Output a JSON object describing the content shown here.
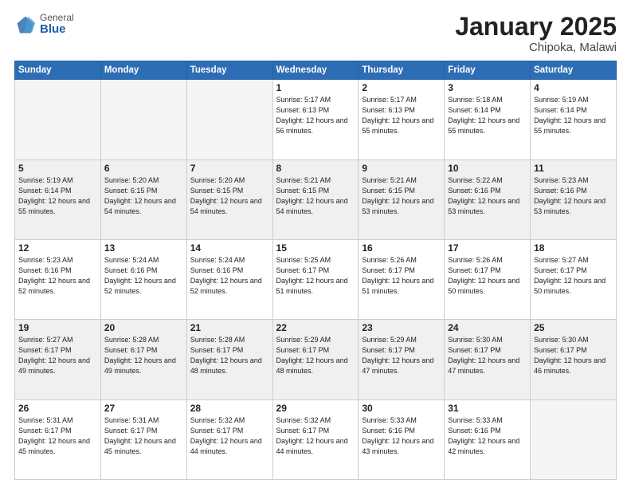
{
  "header": {
    "logo_general": "General",
    "logo_blue": "Blue",
    "month_title": "January 2025",
    "location": "Chipoka, Malawi"
  },
  "weekdays": [
    "Sunday",
    "Monday",
    "Tuesday",
    "Wednesday",
    "Thursday",
    "Friday",
    "Saturday"
  ],
  "weeks": [
    {
      "shaded": false,
      "days": [
        {
          "num": "",
          "info": ""
        },
        {
          "num": "",
          "info": ""
        },
        {
          "num": "",
          "info": ""
        },
        {
          "num": "1",
          "info": "Sunrise: 5:17 AM\nSunset: 6:13 PM\nDaylight: 12 hours\nand 56 minutes."
        },
        {
          "num": "2",
          "info": "Sunrise: 5:17 AM\nSunset: 6:13 PM\nDaylight: 12 hours\nand 55 minutes."
        },
        {
          "num": "3",
          "info": "Sunrise: 5:18 AM\nSunset: 6:14 PM\nDaylight: 12 hours\nand 55 minutes."
        },
        {
          "num": "4",
          "info": "Sunrise: 5:19 AM\nSunset: 6:14 PM\nDaylight: 12 hours\nand 55 minutes."
        }
      ]
    },
    {
      "shaded": true,
      "days": [
        {
          "num": "5",
          "info": "Sunrise: 5:19 AM\nSunset: 6:14 PM\nDaylight: 12 hours\nand 55 minutes."
        },
        {
          "num": "6",
          "info": "Sunrise: 5:20 AM\nSunset: 6:15 PM\nDaylight: 12 hours\nand 54 minutes."
        },
        {
          "num": "7",
          "info": "Sunrise: 5:20 AM\nSunset: 6:15 PM\nDaylight: 12 hours\nand 54 minutes."
        },
        {
          "num": "8",
          "info": "Sunrise: 5:21 AM\nSunset: 6:15 PM\nDaylight: 12 hours\nand 54 minutes."
        },
        {
          "num": "9",
          "info": "Sunrise: 5:21 AM\nSunset: 6:15 PM\nDaylight: 12 hours\nand 53 minutes."
        },
        {
          "num": "10",
          "info": "Sunrise: 5:22 AM\nSunset: 6:16 PM\nDaylight: 12 hours\nand 53 minutes."
        },
        {
          "num": "11",
          "info": "Sunrise: 5:23 AM\nSunset: 6:16 PM\nDaylight: 12 hours\nand 53 minutes."
        }
      ]
    },
    {
      "shaded": false,
      "days": [
        {
          "num": "12",
          "info": "Sunrise: 5:23 AM\nSunset: 6:16 PM\nDaylight: 12 hours\nand 52 minutes."
        },
        {
          "num": "13",
          "info": "Sunrise: 5:24 AM\nSunset: 6:16 PM\nDaylight: 12 hours\nand 52 minutes."
        },
        {
          "num": "14",
          "info": "Sunrise: 5:24 AM\nSunset: 6:16 PM\nDaylight: 12 hours\nand 52 minutes."
        },
        {
          "num": "15",
          "info": "Sunrise: 5:25 AM\nSunset: 6:17 PM\nDaylight: 12 hours\nand 51 minutes."
        },
        {
          "num": "16",
          "info": "Sunrise: 5:26 AM\nSunset: 6:17 PM\nDaylight: 12 hours\nand 51 minutes."
        },
        {
          "num": "17",
          "info": "Sunrise: 5:26 AM\nSunset: 6:17 PM\nDaylight: 12 hours\nand 50 minutes."
        },
        {
          "num": "18",
          "info": "Sunrise: 5:27 AM\nSunset: 6:17 PM\nDaylight: 12 hours\nand 50 minutes."
        }
      ]
    },
    {
      "shaded": true,
      "days": [
        {
          "num": "19",
          "info": "Sunrise: 5:27 AM\nSunset: 6:17 PM\nDaylight: 12 hours\nand 49 minutes."
        },
        {
          "num": "20",
          "info": "Sunrise: 5:28 AM\nSunset: 6:17 PM\nDaylight: 12 hours\nand 49 minutes."
        },
        {
          "num": "21",
          "info": "Sunrise: 5:28 AM\nSunset: 6:17 PM\nDaylight: 12 hours\nand 48 minutes."
        },
        {
          "num": "22",
          "info": "Sunrise: 5:29 AM\nSunset: 6:17 PM\nDaylight: 12 hours\nand 48 minutes."
        },
        {
          "num": "23",
          "info": "Sunrise: 5:29 AM\nSunset: 6:17 PM\nDaylight: 12 hours\nand 47 minutes."
        },
        {
          "num": "24",
          "info": "Sunrise: 5:30 AM\nSunset: 6:17 PM\nDaylight: 12 hours\nand 47 minutes."
        },
        {
          "num": "25",
          "info": "Sunrise: 5:30 AM\nSunset: 6:17 PM\nDaylight: 12 hours\nand 46 minutes."
        }
      ]
    },
    {
      "shaded": false,
      "days": [
        {
          "num": "26",
          "info": "Sunrise: 5:31 AM\nSunset: 6:17 PM\nDaylight: 12 hours\nand 45 minutes."
        },
        {
          "num": "27",
          "info": "Sunrise: 5:31 AM\nSunset: 6:17 PM\nDaylight: 12 hours\nand 45 minutes."
        },
        {
          "num": "28",
          "info": "Sunrise: 5:32 AM\nSunset: 6:17 PM\nDaylight: 12 hours\nand 44 minutes."
        },
        {
          "num": "29",
          "info": "Sunrise: 5:32 AM\nSunset: 6:17 PM\nDaylight: 12 hours\nand 44 minutes."
        },
        {
          "num": "30",
          "info": "Sunrise: 5:33 AM\nSunset: 6:16 PM\nDaylight: 12 hours\nand 43 minutes."
        },
        {
          "num": "31",
          "info": "Sunrise: 5:33 AM\nSunset: 6:16 PM\nDaylight: 12 hours\nand 42 minutes."
        },
        {
          "num": "",
          "info": ""
        }
      ]
    }
  ]
}
